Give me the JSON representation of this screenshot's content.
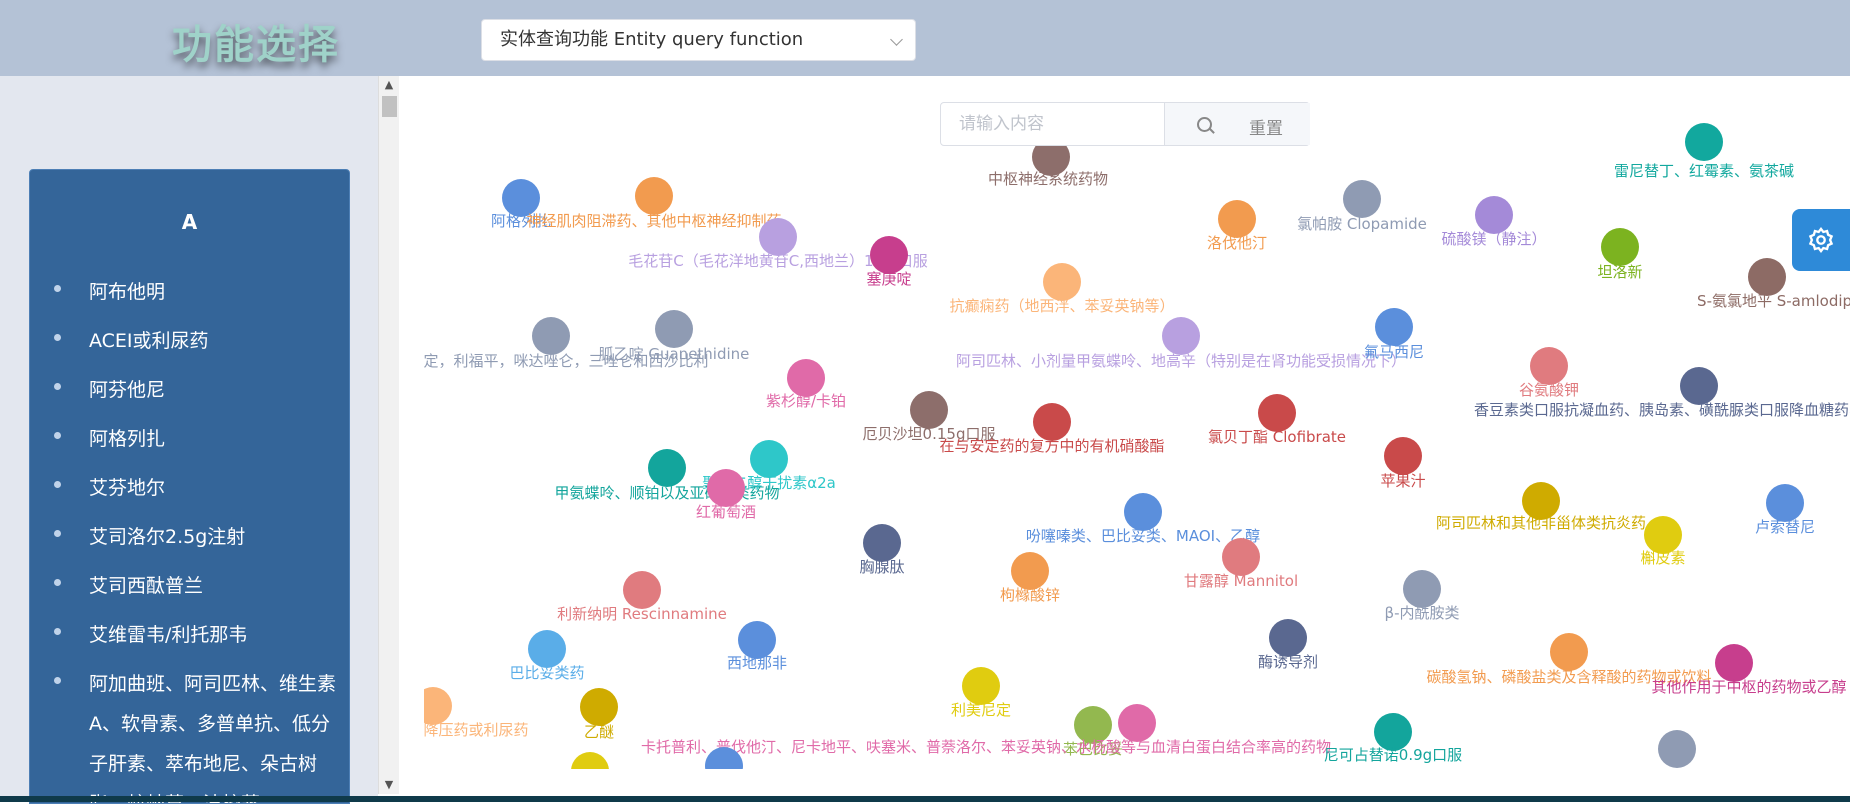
{
  "header": {
    "brand": "功能选择",
    "function_select": {
      "value": "实体查询功能 Entity query function"
    }
  },
  "search": {
    "placeholder": "请输入内容",
    "reset_label": "重置"
  },
  "sidebar": {
    "section_letter": "A",
    "items": [
      "阿布他明",
      "ACEI或利尿药",
      "阿芬他尼",
      "阿格列扎",
      "艾芬地尔",
      "艾司洛尔2.5g注射",
      "艾司西酞普兰",
      "艾维雷韦/利托那韦",
      "阿加曲班、阿司匹林、维生素A、软骨素、多普单抗、低分子肝素、萃布地尼、朵古树脂、蚊蚋草、波校蒸"
    ]
  },
  "graph": {
    "nodes": [
      {
        "label": "中枢神经系统药物",
        "color": "#8d6e6b"
      },
      {
        "label": "雷尼替丁、红霉素、氨茶碱",
        "color": "#12a89e"
      },
      {
        "label": "阿格列扎",
        "color": "#5b8fdc"
      },
      {
        "label": "神经肌肉阻滞药、其他中枢神经抑制药",
        "color": "#f29b4f"
      },
      {
        "label": "氯帕胺 Clopamide",
        "color": "#8f9bb3"
      },
      {
        "label": "硫酸镁（静注）",
        "color": "#a48ad8"
      },
      {
        "label": "洛伐他汀",
        "color": "#f29b4f"
      },
      {
        "label": "坦洛新",
        "color": "#7cb320"
      },
      {
        "label": "S-氨氯地平 S-amlodipine",
        "color": "#8d6b65"
      },
      {
        "label": "毛花苷C（毛花洋地黄苷C,西地兰）1mg口服",
        "color": "#b8a0e0"
      },
      {
        "label": "塞庚啶",
        "color": "#c73e8d"
      },
      {
        "label": "抗癫痫药（地西泮、苯妥英钠等）",
        "color": "#fbb579"
      },
      {
        "label": "非那定，利福平，咪达唑仑，三唑仑和西沙比利",
        "color": "#8f9bb3"
      },
      {
        "label": "胍乙啶 Guanethidine",
        "color": "#8f9bb3"
      },
      {
        "label": "阿司匹林、小剂量甲氨蝶呤、地高辛（特别是在肾功能受损情况下）",
        "color": "#b8a0e0"
      },
      {
        "label": "氟马西尼",
        "color": "#5b8fdc"
      },
      {
        "label": "谷氨酸钾",
        "color": "#e07b7f"
      },
      {
        "label": "香豆素类口服抗凝血药、胰岛素、磺酰脲类口服降血糖药、甲氨蝶呤",
        "color": "#5a6890"
      },
      {
        "label": "紫杉醇/卡铂",
        "color": "#e06aa8"
      },
      {
        "label": "厄贝沙坦0.15g口服",
        "color": "#8d6e6b"
      },
      {
        "label": "在与安定药的复方中的有机硝酸酯",
        "color": "#c94a4a"
      },
      {
        "label": "氯贝丁酯 Clofibrate",
        "color": "#c94a4a"
      },
      {
        "label": "苹果汁",
        "color": "#c94a4a"
      },
      {
        "label": "甲氨蝶呤、顺铂以及亚硝脲类药物",
        "color": "#13a59c"
      },
      {
        "label": "聚乙二醇干扰素α2a",
        "color": "#2ec7c9"
      },
      {
        "label": "红葡萄酒",
        "color": "#e06aa8"
      },
      {
        "label": "阿司匹林和其他非甾体类抗炎药",
        "color": "#cfab00"
      },
      {
        "label": "卢索替尼",
        "color": "#5b8fdc"
      },
      {
        "label": "吩噻嗪类、巴比妥类、MAOI、乙醇",
        "color": "#5b8fdc"
      },
      {
        "label": "槲皮素",
        "color": "#e0cc10"
      },
      {
        "label": "胸腺肽",
        "color": "#5a6890"
      },
      {
        "label": "枸橼酸锌",
        "color": "#f29b4f"
      },
      {
        "label": "甘露醇 Mannitol",
        "color": "#e07b7f"
      },
      {
        "label": "β-内酰胺类",
        "color": "#8f9bb3"
      },
      {
        "label": "利新纳明 Rescinnamine",
        "color": "#e07b7f"
      },
      {
        "label": "巴比妥类药",
        "color": "#5aade8"
      },
      {
        "label": "西地那非",
        "color": "#5b8fdc"
      },
      {
        "label": "酶诱导剂",
        "color": "#5a6890"
      },
      {
        "label": "碳酸氢钠、磷酸盐类及含释酸的药物或饮料",
        "color": "#f29b4f"
      },
      {
        "label": "其他作用于中枢的药物或乙醇",
        "color": "#c73e8d"
      },
      {
        "label": "降压药或利尿药",
        "color": "#fbb579"
      },
      {
        "label": "乙醚",
        "color": "#cfab00"
      },
      {
        "label": "利美尼定",
        "color": "#e0cc10"
      },
      {
        "label": "苯巴比妥",
        "color": "#93b84f"
      },
      {
        "label": "卡托普利、普伐他汀、尼卡地平、呋塞米、普萘洛尔、苯妥英钠、水杨酸等与血清白蛋白结合率高的药物",
        "color": "#e06aa8"
      },
      {
        "label": "尼可占替诺0.9g口服",
        "color": "#13a59c"
      },
      {
        "label": "",
        "color": "#8f9bb3"
      },
      {
        "label": "",
        "color": "#5b8fdc"
      },
      {
        "label": "",
        "color": "#e0cc10"
      }
    ]
  }
}
